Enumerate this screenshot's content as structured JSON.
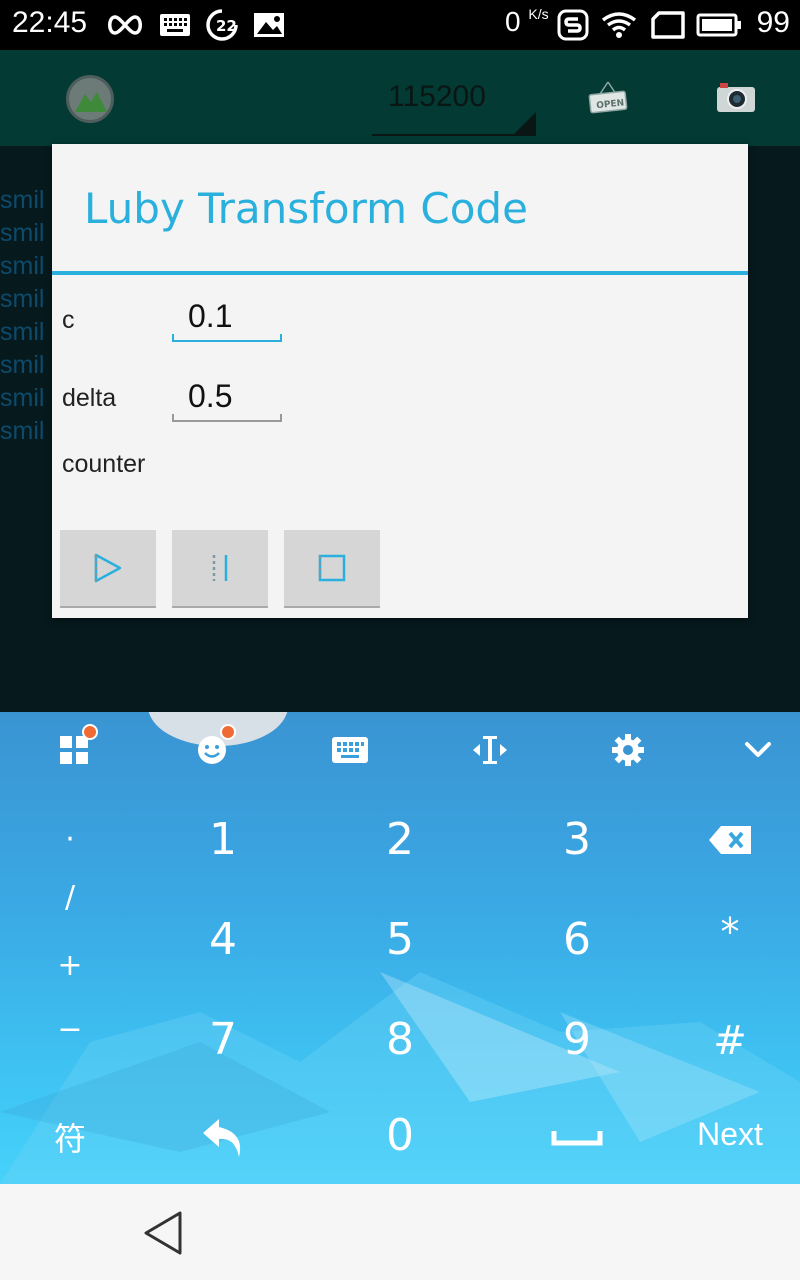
{
  "status_bar": {
    "time": "22:45",
    "notification_count": "22",
    "net_speed_value": "0",
    "net_speed_unit": "K/s",
    "battery_level": "99",
    "icons": [
      "infinity-icon",
      "keyboard-icon",
      "badge-22-icon",
      "image-icon",
      "s-app-icon",
      "wifi-icon",
      "screen-rotate-icon",
      "battery-icon"
    ]
  },
  "toolbar": {
    "baud_rate": "115200",
    "icons": [
      "app-logo-icon",
      "open-sign-icon",
      "camera-icon"
    ]
  },
  "log_lines": [
    "smil",
    "smil",
    "smil",
    "smil",
    "smil",
    "smil",
    "smil",
    "smil"
  ],
  "dialog": {
    "title": "Luby Transform Code",
    "fields": {
      "c_label": "c",
      "c_value": "0.1",
      "delta_label": "delta",
      "delta_value": "0.5",
      "counter_label": "counter"
    },
    "buttons": [
      "play-icon",
      "pause-icon",
      "stop-icon"
    ]
  },
  "keyboard": {
    "toolbar_icons": [
      "apps-grid-icon",
      "emoji-icon",
      "keyboard-icon",
      "cursor-move-icon",
      "settings-gear-icon",
      "collapse-chevron-icon"
    ],
    "side_keys": [
      "·",
      "/",
      "+",
      "−"
    ],
    "row1": [
      "1",
      "2",
      "3"
    ],
    "row2": [
      "4",
      "5",
      "6"
    ],
    "row3": [
      "7",
      "8",
      "9"
    ],
    "right_keys": [
      "*",
      "#"
    ],
    "bottom": {
      "symbols": "符",
      "zero": "0",
      "next": "Next"
    }
  },
  "colors": {
    "accent": "#2ab0dc",
    "toolbar": "#033a33",
    "notification_dot": "#f06a36"
  }
}
